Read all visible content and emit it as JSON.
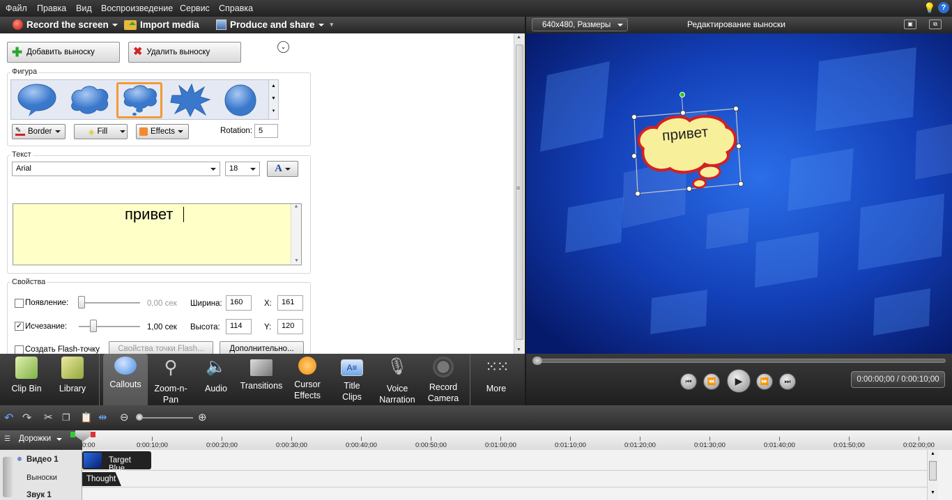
{
  "menu": [
    "Файл",
    "Правка",
    "Вид",
    "Воспроизведение",
    "Сервис",
    "Справка"
  ],
  "toolbar": {
    "record_label": "Record the screen",
    "import_label": "Import media",
    "share_label": "Produce and share"
  },
  "callout": {
    "add_label": "Добавить выноску",
    "remove_label": "Удалить выноску",
    "shape_group_label": "Фигура",
    "border_label": "Border",
    "fill_label": "Fill",
    "effects_label": "Effects",
    "rotation_label": "Rotation:",
    "rotation_value": "5",
    "text_group_label": "Текст",
    "font_name": "Arial",
    "font_size": "18",
    "text_value": "привет",
    "props_group_label": "Свойства",
    "fade_in_label": "Появление:",
    "fade_in_value": "0,00 сек",
    "fade_out_label": "Исчезание:",
    "fade_out_value": "1,00 сек",
    "width_label": "Ширина:",
    "width_value": "160",
    "height_label": "Высота:",
    "height_value": "114",
    "x_label": "X:",
    "x_value": "161",
    "y_label": "Y:",
    "y_value": "120",
    "flash_label": "Создать Flash-точку",
    "flash_props_label": "Свойства точки Flash...",
    "more_label": "Дополнительно..."
  },
  "preview": {
    "size_label": "640x480, Размеры",
    "title": "Редактирование выноски",
    "callout_text": "привет",
    "time": "0:00:00;00 / 0:00:10;00"
  },
  "tasks": [
    {
      "label1": "Clip Bin",
      "label2": ""
    },
    {
      "label1": "Library",
      "label2": ""
    },
    {
      "label1": "Callouts",
      "label2": ""
    },
    {
      "label1": "Zoom-n-",
      "label2": "Pan"
    },
    {
      "label1": "Audio",
      "label2": ""
    },
    {
      "label1": "Transitions",
      "label2": ""
    },
    {
      "label1": "Cursor",
      "label2": "Effects"
    },
    {
      "label1": "Title",
      "label2": "Clips"
    },
    {
      "label1": "Voice",
      "label2": "Narration"
    },
    {
      "label1": "Record",
      "label2": "Camera"
    },
    {
      "label1": "More",
      "label2": ""
    }
  ],
  "timeline": {
    "tracks_label": "Дорожки",
    "ticks": [
      "0:00",
      "0:00:10;00",
      "0:00:20;00",
      "0:00:30;00",
      "0:00:40;00",
      "0:00:50;00",
      "0:01:00;00",
      "0:01:10;00",
      "0:01:20;00",
      "0:01:30;00",
      "0:01:40;00",
      "0:01:50;00",
      "0:02:00;00"
    ],
    "track_video": "Видео 1",
    "track_callouts": "Выноски",
    "track_audio": "Звук 1",
    "clip_video": "Target Blue.",
    "clip_callout": "Thought"
  },
  "colors": {
    "accent": "#f29b32",
    "canvas_bg": "#0d2b8f",
    "callout_fill": "#f7ef9a",
    "callout_border": "#d42020",
    "text_area_bg": "#ffffc8"
  }
}
